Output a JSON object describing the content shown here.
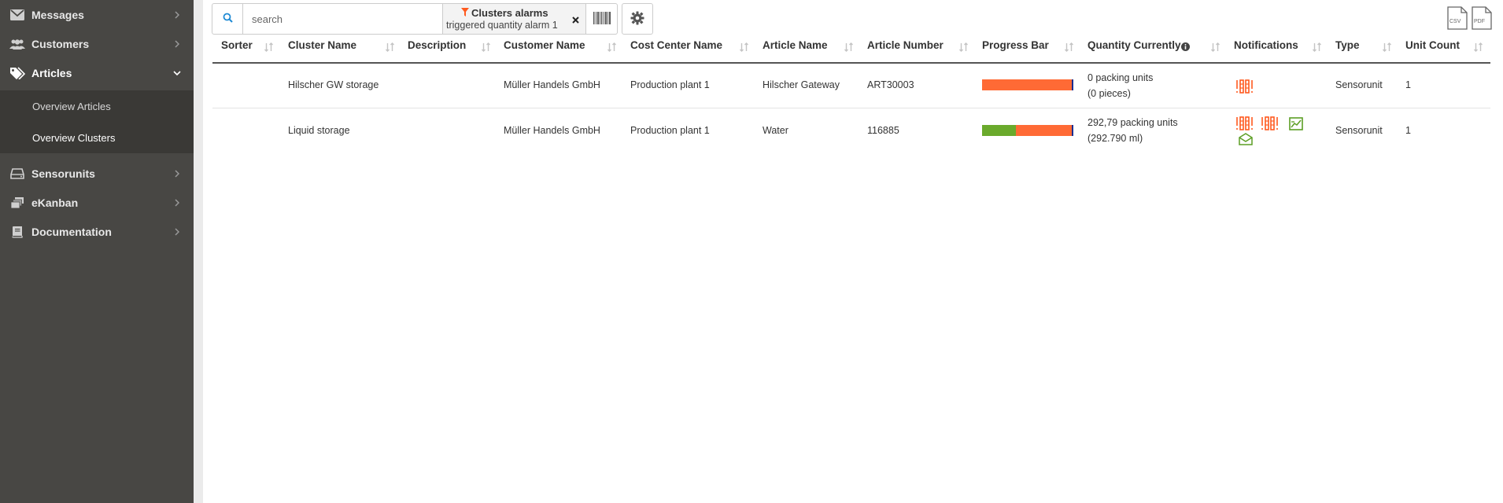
{
  "sidebar": {
    "items": [
      {
        "label": "Messages"
      },
      {
        "label": "Customers"
      },
      {
        "label": "Articles"
      },
      {
        "label": "Sensorunits"
      },
      {
        "label": "eKanban"
      },
      {
        "label": "Documentation"
      }
    ],
    "subitems": [
      {
        "label": "Overview Articles"
      },
      {
        "label": "Overview Clusters"
      }
    ]
  },
  "toolbar": {
    "search_placeholder": "search",
    "filter_title": "Clusters alarms",
    "filter_value": "triggered quantity alarm 1"
  },
  "exports": {
    "csv": "CSV",
    "pdf": "PDF"
  },
  "table": {
    "columns": [
      "Sorter",
      "Cluster Name",
      "Description",
      "Customer Name",
      "Cost Center Name",
      "Article Name",
      "Article Number",
      "Progress Bar",
      "Quantity Currently",
      "Notifications",
      "Type",
      "Unit Count"
    ],
    "rows": [
      {
        "cluster_name": "Hilscher GW storage",
        "customer_name": "Müller Handels GmbH",
        "cost_center": "Production plant 1",
        "article_name": "Hilscher Gateway",
        "article_number": "ART30003",
        "progress": {
          "green": 0,
          "orange": 1
        },
        "qty_line1": "0 packing units",
        "qty_line2": "(0 pieces)",
        "type": "Sensorunit",
        "unit_count": "1"
      },
      {
        "cluster_name": "Liquid storage",
        "customer_name": "Müller Handels GmbH",
        "cost_center": "Production plant 1",
        "article_name": "Water",
        "article_number": "116885",
        "progress": {
          "green": 0.38,
          "orange": 0.62
        },
        "qty_line1": "292,79 packing units",
        "qty_line2": "(292.790 ml)",
        "type": "Sensorunit",
        "unit_count": "1"
      }
    ]
  },
  "colors": {
    "alarm": "#ff5a1f",
    "ok": "#6aaa2c",
    "sidebar": "#484744"
  }
}
